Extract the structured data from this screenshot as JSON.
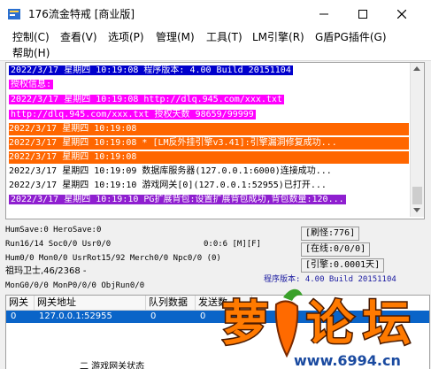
{
  "window": {
    "title": "176流金特戒 [商业版]"
  },
  "menu": [
    {
      "label": "控制(C)"
    },
    {
      "label": "查看(V)"
    },
    {
      "label": "选项(P)"
    },
    {
      "label": "管理(M)"
    },
    {
      "label": "工具(T)"
    },
    {
      "label": "LM引擎(R)"
    },
    {
      "label": "G盾PG插件(G)"
    },
    {
      "label": "帮助(H)"
    }
  ],
  "log": [
    {
      "text": "2022/3/17 星期四 10:19:08 程序版本: 4.00 Build 20151104",
      "style": "blue"
    },
    {
      "text": "授权信息:",
      "style": "magenta"
    },
    {
      "text": "2022/3/17 星期四 10:19:08 http://dlq.945.com/xxx.txt",
      "style": "magenta"
    },
    {
      "text": "http://dlq.945.com/xxx.txt 授权天数 98659/99999",
      "style": "magenta"
    },
    {
      "text": "2022/3/17 星期四 10:19:08",
      "style": "orange"
    },
    {
      "text": "2022/3/17 星期四 10:19:08 * [LM反外挂引擎v3.41]:引擎漏洞修复成功...",
      "style": "orange"
    },
    {
      "text": "2022/3/17 星期四 10:19:08",
      "style": "orange"
    },
    {
      "text": "2022/3/17 星期四 10:19:09 数据库服务器(127.0.0.1:6000)连接成功...",
      "style": "plain"
    },
    {
      "text": "2022/3/17 星期四 10:19:10 游戏网关[0](127.0.0.1:52955)已打开...",
      "style": "plain"
    },
    {
      "text": "2022/3/17 星期四 10:19:10 PG扩展背包:设置扩展背包成功,背包数量:120...",
      "style": "purple"
    }
  ],
  "status": {
    "line1": "HumSave:0 HeroSave:0",
    "line2a": "Run16/14 Soc0/0 Usr0/0",
    "line2b": "0:0:6 [M][F]",
    "line3": "Hum0/0 Mon0/0 UsrRot15/92 Merch0/0 Npc0/0 (0)",
    "line4": "祖玛卫士,46/2368 -",
    "line5": "MonG0/0/0 MonP0/0/0 ObjRun0/0",
    "refresh": "[刷怪:776]",
    "online": "[在线:0/0/0]",
    "engine": "[引擎:0.0001天]",
    "version": "程序版本: 4.00 Build 20151104"
  },
  "table": {
    "headers": [
      "网关",
      "网关地址",
      "队列数据",
      "发送数"
    ],
    "rows": [
      [
        "0",
        "127.0.0.1:52955",
        "0",
        "0"
      ]
    ]
  },
  "bottom_text": "二 游戏网关状态",
  "watermark": {
    "logo_text": "萝卜论坛",
    "url": "www.6994.cn"
  },
  "colors": {
    "log_blue": "#0000cc",
    "log_magenta": "#ff00ff",
    "log_orange": "#ff6600",
    "log_purple": "#8f1fd0",
    "selection": "#0a64c8"
  }
}
